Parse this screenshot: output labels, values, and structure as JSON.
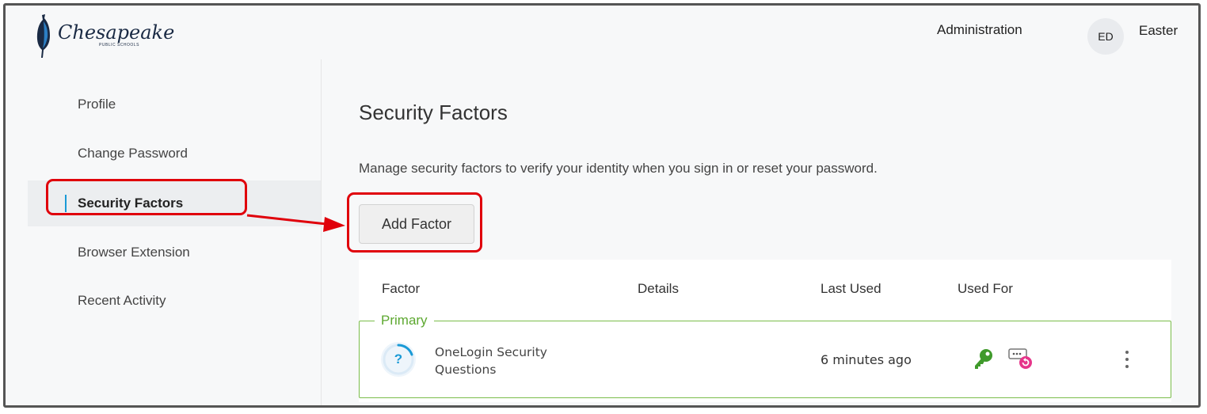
{
  "header": {
    "logo_text": "Chesapeake",
    "logo_subtext": "PUBLIC SCHOOLS",
    "admin_link": "Administration",
    "user_initials": "ED",
    "user_name": "Easter"
  },
  "sidebar": {
    "items": [
      {
        "label": "Profile"
      },
      {
        "label": "Change Password"
      },
      {
        "label": "Security Factors",
        "active": true
      },
      {
        "label": "Browser Extension"
      },
      {
        "label": "Recent Activity"
      }
    ]
  },
  "main": {
    "title": "Security Factors",
    "description": "Manage security factors to verify your identity when you sign in or reset your password.",
    "add_button": "Add Factor",
    "table": {
      "headers": [
        "Factor",
        "Details",
        "Last Used",
        "Used For"
      ],
      "group_label": "Primary",
      "rows": [
        {
          "factor": "OneLogin Security Questions",
          "factor_line1": "OneLogin Security",
          "factor_line2": "Questions",
          "icon_text": "?",
          "details": "",
          "last_used": "6 minutes ago",
          "used_for_icons": [
            "key-icon",
            "password-reset-icon"
          ]
        }
      ]
    }
  },
  "colors": {
    "accent_blue": "#1a9ad6",
    "primary_green": "#5da830",
    "annotation_red": "#e0000b",
    "key_green": "#3f9a2b",
    "reset_pink": "#e6358a"
  }
}
